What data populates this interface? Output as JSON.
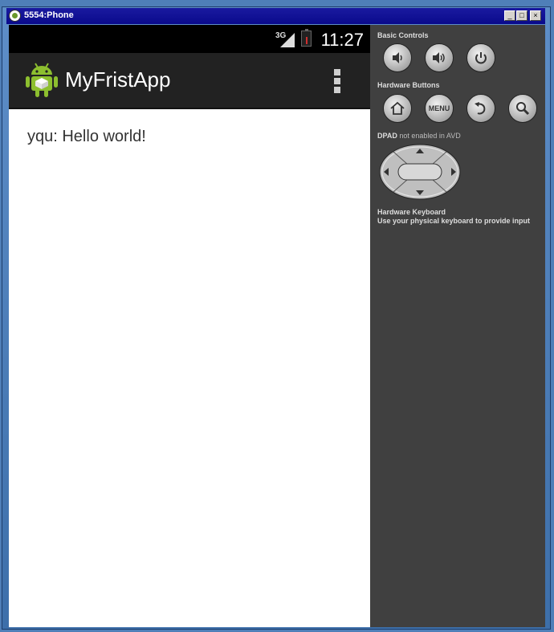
{
  "window": {
    "title": "5554:Phone",
    "minimize": "_",
    "maximize": "□",
    "close": "×"
  },
  "status_bar": {
    "network": "3G",
    "time": "11:27"
  },
  "action_bar": {
    "app_title": "MyFristApp"
  },
  "content": {
    "text": "yqu: Hello world!"
  },
  "controls": {
    "basic_label": "Basic Controls",
    "hardware_label": "Hardware Buttons",
    "menu_label": "MENU",
    "dpad_label": "DPAD",
    "dpad_note": "not enabled in AVD",
    "keyboard_title": "Hardware Keyboard",
    "keyboard_note": "Use your physical keyboard to provide input"
  }
}
